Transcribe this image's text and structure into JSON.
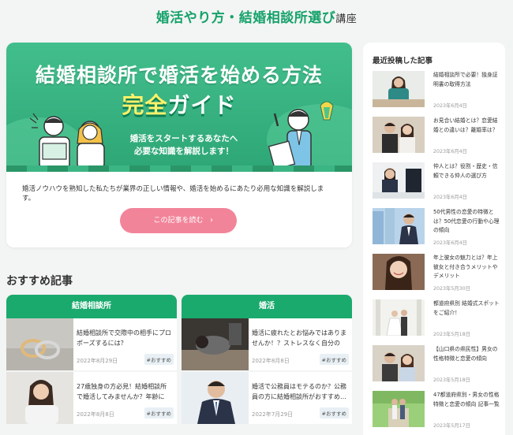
{
  "site": {
    "title_main": "婚活やり方・結婚相談所選び",
    "title_suffix": "講座"
  },
  "hero": {
    "banner_line1": "結婚相談所で婚活を始める方法",
    "banner_highlight": "完全",
    "banner_rest": "ガイド",
    "banner_sub_line1": "婚活をスタートするあなたへ",
    "banner_sub_line2": "必要な知識を解説します！",
    "description": "婚活ノウハウを熟知した私たちが業界の正しい情報や、婚活を始めるにあたり必用な知識を解説します。",
    "button_label": "この記事を読む",
    "button_arrow": "›"
  },
  "recommend": {
    "heading": "おすすめ記事",
    "columns": [
      {
        "category": "結婚相談所",
        "items": [
          {
            "title": "結婚相談所で交際中の相手にプロポーズするには？",
            "date": "2022年8月29日",
            "tag": "#おすすめ"
          },
          {
            "title": "27歳独身の方必見！結婚相談所で婚活してみませんか？年齢に合…",
            "date": "2022年8月8日",
            "tag": "#おすすめ"
          }
        ]
      },
      {
        "category": "婚活",
        "items": [
          {
            "title": "婚活に疲れたとお悩みではありませんか！？ストレスなく自分のペ…",
            "date": "2022年8月8日",
            "tag": "#おすすめ"
          },
          {
            "title": "婚活で公務員はモテるのか？公務員の方に結婚相談所がおすすめ…",
            "date": "2022年7月29日",
            "tag": "#おすすめ"
          }
        ]
      }
    ]
  },
  "sidebar": {
    "heading": "最近投稿した記事",
    "items": [
      {
        "title": "結婚相談所で必要！独身証明書の取得方法",
        "date": "2023年6月4日"
      },
      {
        "title": "お見合い結婚とは？恋愛結婚との違いは？離婚率は？",
        "date": "2023年6月4日"
      },
      {
        "title": "仲人とは？役割・歴史・信頼できる仲人の選び方",
        "date": "2023年6月4日"
      },
      {
        "title": "50代男性の恋愛の特徴とは？50代恋愛の行動や心理の傾向",
        "date": "2023年6月4日"
      },
      {
        "title": "年上彼女の魅力とは？年上彼女と付き合うメリットやデメリット",
        "date": "2023年5月30日"
      },
      {
        "title": "都道府県別 結婚式スポットをご紹介！",
        "date": "2023年5月18日"
      },
      {
        "title": "【山口県の県民性】男女の性格特徴と恋愛の傾向",
        "date": "2023年5月18日"
      },
      {
        "title": "47都道府県別・男女の性格特徴と恋愛の傾向 記事一覧",
        "date": "2023年5月17日"
      }
    ]
  },
  "colors": {
    "brand_green": "#16a26a",
    "category_header": "#1aaa6e",
    "button_pink": "#f2849a",
    "highlight_yellow": "#fff16a"
  }
}
